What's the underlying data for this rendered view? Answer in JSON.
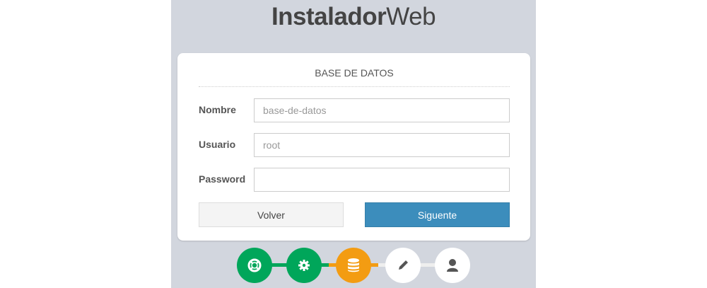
{
  "header": {
    "title_bold": "Instalador",
    "title_light": "Web"
  },
  "section_title": "BASE DE DATOS",
  "form": {
    "nombre": {
      "label": "Nombre",
      "placeholder": "base-de-datos",
      "value": ""
    },
    "usuario": {
      "label": "Usuario",
      "placeholder": "root",
      "value": ""
    },
    "password": {
      "label": "Password",
      "placeholder": "",
      "value": ""
    }
  },
  "buttons": {
    "back": "Volver",
    "next": "Siguente"
  },
  "steps": [
    {
      "icon": "life-ring-icon",
      "state": "done"
    },
    {
      "icon": "gear-icon",
      "state": "done"
    },
    {
      "icon": "database-icon",
      "state": "active"
    },
    {
      "icon": "pencil-icon",
      "state": "pending"
    },
    {
      "icon": "user-icon",
      "state": "pending"
    }
  ],
  "colors": {
    "done": "#00a65a",
    "active": "#f39c12",
    "pending": "#ffffff",
    "primary": "#3c8dbc"
  }
}
